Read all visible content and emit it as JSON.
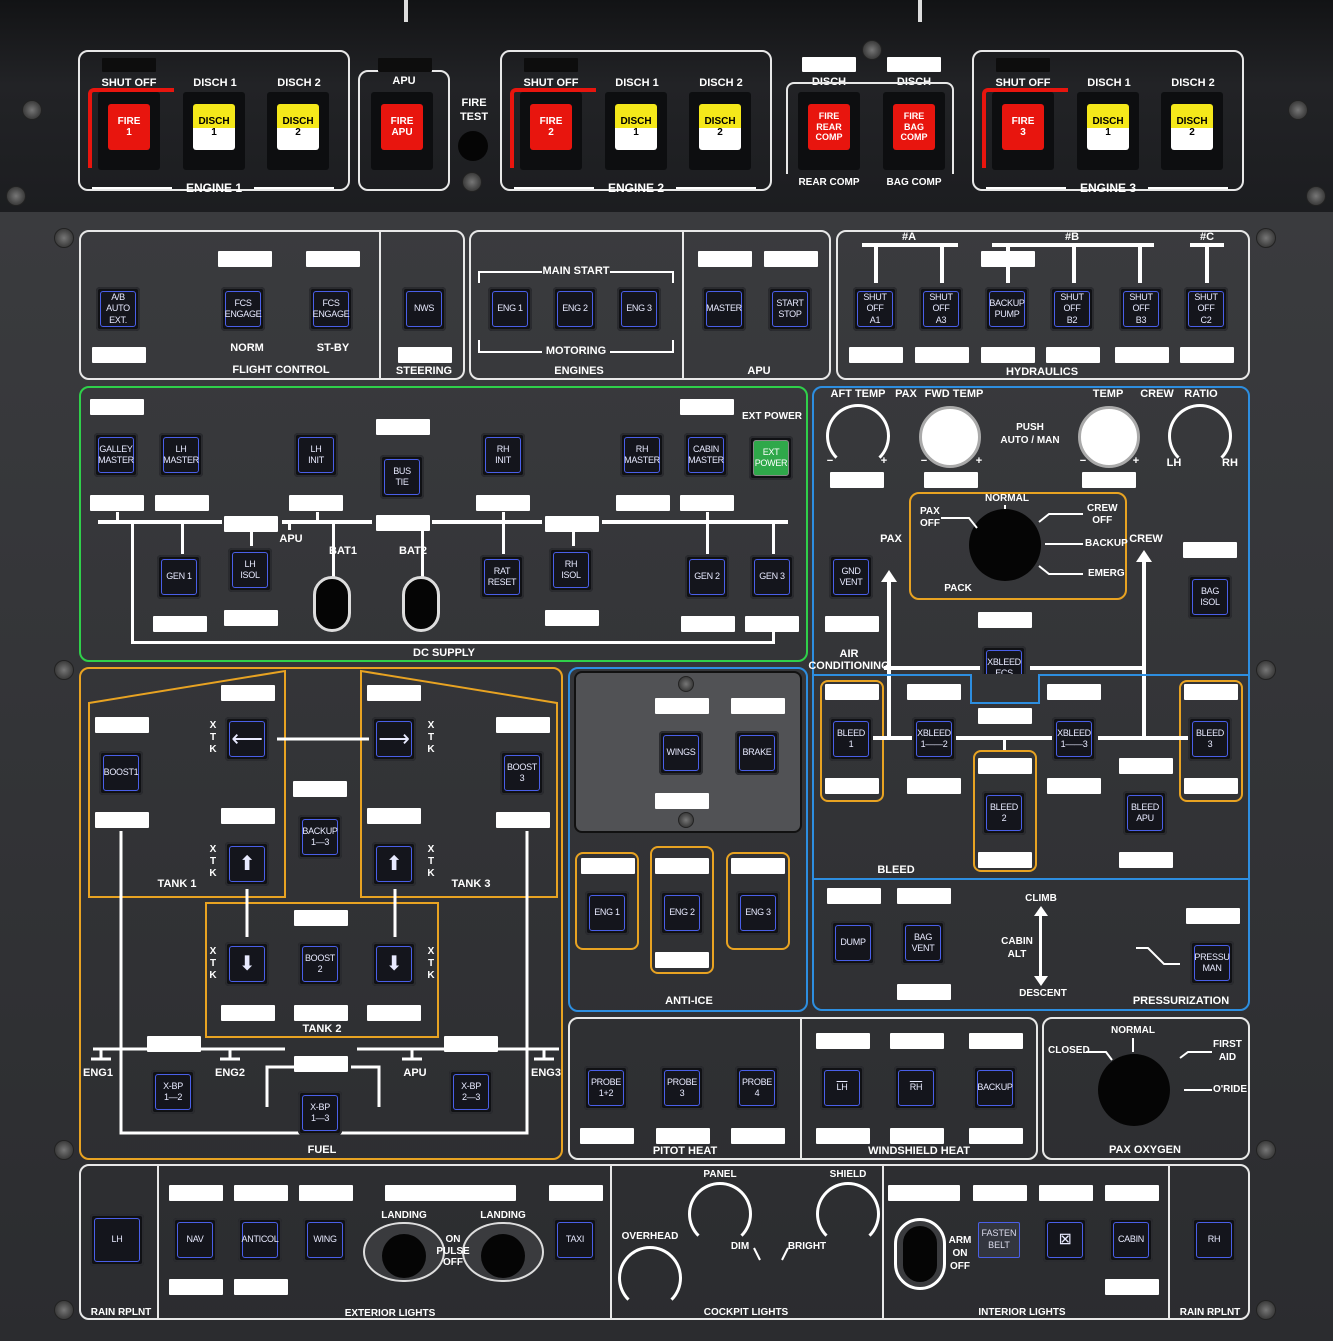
{
  "fire_panel": {
    "engine1": {
      "title": "ENGINE 1",
      "shutoff": "SHUT OFF",
      "disch1": "DISCH 1",
      "disch2": "DISCH 2",
      "fire_btn": "FIRE\n1",
      "d1_btn": "DISCH\n1",
      "d2_btn": "DISCH\n2"
    },
    "apu": {
      "title": "APU",
      "fire_btn": "FIRE\nAPU"
    },
    "fire_test": "FIRE\nTEST",
    "engine2": {
      "title": "ENGINE 2",
      "shutoff": "SHUT OFF",
      "disch1": "DISCH 1",
      "disch2": "DISCH 2",
      "fire_btn": "FIRE\n2",
      "d1_btn": "DISCH\n1",
      "d2_btn": "DISCH\n2"
    },
    "comp": {
      "disch_a": "DISCH",
      "disch_b": "DISCH",
      "rear_btn": "FIRE\nREAR\nCOMP",
      "bag_btn": "FIRE\nBAG\nCOMP",
      "rear_label": "REAR COMP",
      "bag_label": "BAG COMP"
    },
    "engine3": {
      "title": "ENGINE 3",
      "shutoff": "SHUT OFF",
      "disch1": "DISCH 1",
      "disch2": "DISCH 2",
      "fire_btn": "FIRE\n3",
      "d1_btn": "DISCH\n1",
      "d2_btn": "DISCH\n2"
    }
  },
  "flight_control": {
    "title": "FLIGHT CONTROL",
    "ab_auto": "A/B AUTO\nEXT.",
    "fcs1": "FCS\nENGAGE",
    "fcs2": "FCS\nENGAGE",
    "norm": "NORM",
    "stby": "ST-BY"
  },
  "steering": {
    "title": "STEERING",
    "nws": "NWS"
  },
  "engines": {
    "title": "ENGINES",
    "main_start": "MAIN START",
    "motoring": "MOTORING",
    "eng1": "ENG 1",
    "eng2": "ENG 2",
    "eng3": "ENG 3"
  },
  "apu": {
    "title": "APU",
    "master": "MASTER",
    "start": "START\nSTOP"
  },
  "hydraulics": {
    "title": "HYDRAULICS",
    "a": "#A",
    "b": "#B",
    "c": "#C",
    "a1": "SHUT OFF\nA1",
    "a3": "SHUT OFF\nA3",
    "backup": "BACKUP\nPUMP",
    "b2": "SHUT OFF\nB2",
    "b3": "SHUT OFF\nB3",
    "c2": "SHUT OFF\nC2"
  },
  "ext_power": {
    "label": "EXT  POWER",
    "btn": "EXT\nPOWER"
  },
  "dc_supply": {
    "title": "DC SUPPLY",
    "galley": "GALLEY\nMASTER",
    "lh_master": "LH\nMASTER",
    "lh_init": "LH\nINIT",
    "bus_tie": "BUS\nTIE",
    "rh_init": "RH\nINIT",
    "rh_master": "RH\nMASTER",
    "cabin": "CABIN\nMASTER",
    "gen1": "GEN 1",
    "lh_isol": "LH\nISOL",
    "apu": "APU",
    "bat1": "BAT1",
    "bat2": "BAT2",
    "rat": "RAT\nRESET",
    "rh_isol": "RH\nISOL",
    "gen2": "GEN 2",
    "gen3": "GEN 3"
  },
  "air_cond": {
    "aft_temp": "AFT TEMP",
    "pax": "PAX",
    "fwd_temp": "FWD TEMP",
    "push": "PUSH\nAUTO / MAN",
    "temp": "TEMP",
    "crew": "CREW",
    "ratio": "RATIO",
    "minus": "−",
    "plus": "+",
    "lh": "LH",
    "rh": "RH",
    "normal": "NORMAL",
    "pax_off": "PAX\nOFF",
    "crew_off": "CREW\nOFF",
    "backup": "BACKUP",
    "emerg": "EMERG",
    "pack": "PACK",
    "pax2": "PAX",
    "crew2": "CREW",
    "gnd_vent": "GND\nVENT",
    "bag_isol": "BAG\nISOL",
    "title": "AIR\nCONDITIONING",
    "xbleed_ecs": "XBLEED\nECS"
  },
  "bleed": {
    "title": "BLEED",
    "bleed1": "BLEED 1",
    "xb12": "XBLEED\n1——2",
    "bleed2": "BLEED 2",
    "xb13": "XBLEED\n1——3",
    "bleed3": "BLEED 3",
    "bleed_apu": "BLEED\nAPU"
  },
  "fuel": {
    "title": "FUEL",
    "xtk": "X\nT\nK",
    "boost1": "BOOST1",
    "boost3": "BOOST 3",
    "backup": "BACKUP\n1—3",
    "tank1": "TANK 1",
    "tank3": "TANK 3",
    "tank2": "TANK 2",
    "boost2": "BOOST 2",
    "eng1": "ENG1",
    "eng2": "ENG2",
    "apu": "APU",
    "eng3": "ENG3",
    "xbp12": "X-BP\n1—2",
    "xbp13": "X-BP\n1—3",
    "xbp23": "X-BP\n2—3"
  },
  "anti_ice": {
    "title": "ANTI-ICE",
    "wings": "WINGS",
    "brake": "BRAKE",
    "eng1": "ENG 1",
    "eng2": "ENG 2",
    "eng3": "ENG 3"
  },
  "pressurization": {
    "title": "PRESSURIZATION",
    "dump": "DUMP",
    "bag_vent": "BAG\nVENT",
    "climb": "CLIMB",
    "cabin_alt": "CABIN\nALT",
    "descent": "DESCENT",
    "pressu_man": "PRESSU\nMAN"
  },
  "pitot": {
    "title": "PITOT HEAT",
    "p12": "PROBE\n1+2",
    "p3": "PROBE\n3",
    "p4": "PROBE\n4"
  },
  "windshield": {
    "title": "WINDSHIELD HEAT",
    "lh": "LH",
    "rh": "RH",
    "backup": "BACKUP"
  },
  "oxygen": {
    "title": "PAX OXYGEN",
    "normal": "NORMAL",
    "closed": "CLOSED",
    "first_aid": "FIRST\nAID",
    "oride": "O'RIDE"
  },
  "lights": {
    "rain_l": "RAIN RPLNT",
    "lh": "LH",
    "nav": "NAV",
    "anticol": "ANTICOL",
    "wing": "WING",
    "landing1": "LANDING",
    "landing2": "LANDING",
    "on_pulse": "ON\nPULSE\nOFF",
    "taxi": "TAXI",
    "ext_title": "EXTERIOR LIGHTS",
    "panel": "PANEL",
    "shield": "SHIELD",
    "overhead": "OVERHEAD",
    "dim": "DIM",
    "bright": "BRIGHT",
    "cockpit_title": "COCKPIT LIGHTS",
    "arm": "ARM\nON\nOFF",
    "fasten": "FASTEN\nBELT",
    "cabin": "CABIN",
    "int_title": "INTERIOR LIGHTS",
    "rain_r": "RAIN RPLNT",
    "rh": "RH"
  }
}
